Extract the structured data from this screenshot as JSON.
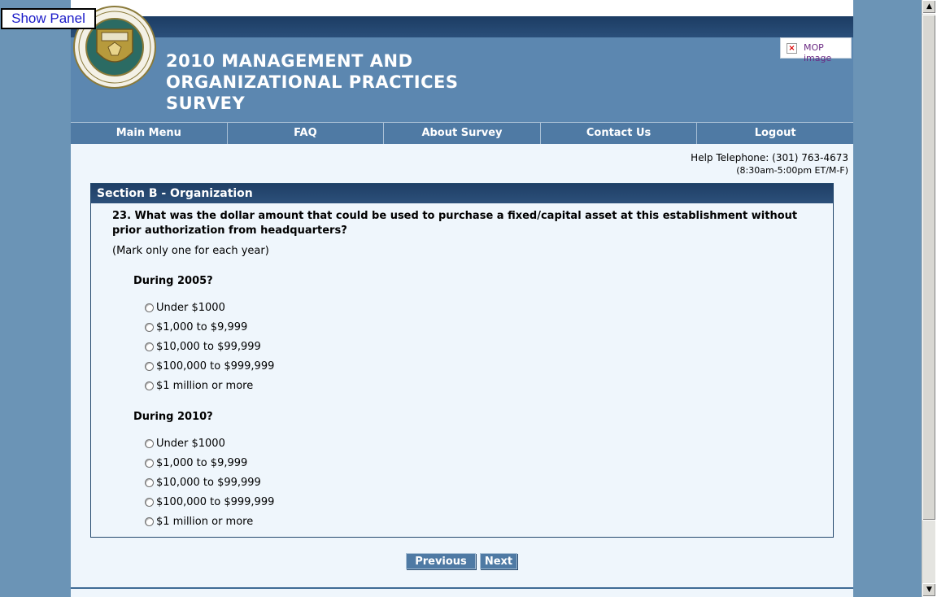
{
  "show_panel": "Show Panel",
  "banner": {
    "title_lines": [
      "2010 MANAGEMENT AND",
      "ORGANIZATIONAL PRACTICES",
      "SURVEY"
    ],
    "mop_image": "MOP image"
  },
  "nav": {
    "items": [
      "Main Menu",
      "FAQ",
      "About Survey",
      "Contact Us",
      "Logout"
    ]
  },
  "help": {
    "telephone": "Help Telephone: (301) 763-4673",
    "hours": "(8:30am-5:00pm ET/M-F)"
  },
  "section": {
    "title": "Section B - Organization",
    "question": "23. What was the dollar amount that could be used to purchase a fixed/capital asset at this establishment without prior authorization from headquarters?",
    "instruction": "(Mark only one for each year)",
    "groups": [
      {
        "label": "During 2005?",
        "options": [
          "Under $1000",
          "$1,000 to $9,999",
          "$10,000 to $99,999",
          "$100,000 to $999,999",
          "$1 million or more"
        ]
      },
      {
        "label": "During 2010?",
        "options": [
          "Under $1000",
          "$1,000 to $9,999",
          "$10,000 to $99,999",
          "$100,000 to $999,999",
          "$1 million or more"
        ]
      }
    ]
  },
  "buttons": {
    "previous": "Previous",
    "next": "Next"
  }
}
